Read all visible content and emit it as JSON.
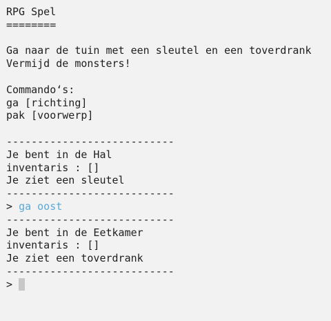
{
  "title": "RPG Spel",
  "title_underline": "========",
  "intro": [
    "Ga naar de tuin met een sleutel en een toverdrank",
    "Vermijd de monsters!"
  ],
  "commands_header": "Commando‘s:",
  "commands": [
    "ga [richting]",
    "pak [voorwerp]"
  ],
  "separator": "---------------------------",
  "room1": {
    "location": "Je bent in de Hal",
    "inventory": "inventaris : []",
    "item": "Je ziet een sleutel"
  },
  "prompt": "> ",
  "entered_command": "ga oost",
  "room2": {
    "location": "Je bent in de Eetkamer",
    "inventory": "inventaris : []",
    "item": "Je ziet een toverdrank"
  },
  "colors": {
    "background": "#f2f2f2",
    "text": "#1e1e1e",
    "command": "#5aa9d6",
    "cursor": "#c8c8c8"
  }
}
